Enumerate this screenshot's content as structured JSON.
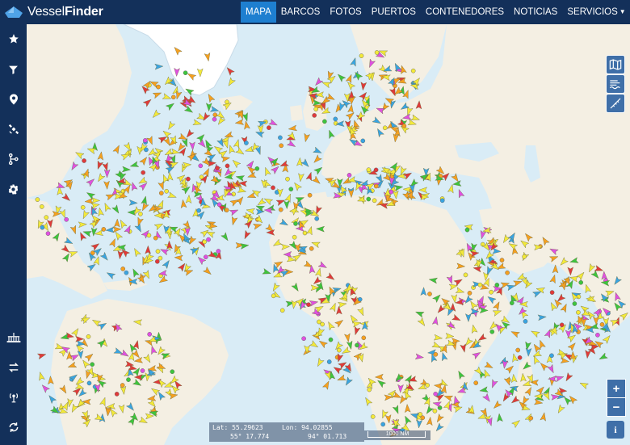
{
  "brand": {
    "name_part1": "Vessel",
    "name_part2": "Finder",
    "accent": "#1e7fd0",
    "navbar_color": "#13305a"
  },
  "nav": {
    "items": [
      {
        "label": "MAPA",
        "active": true
      },
      {
        "label": "BARCOS",
        "active": false
      },
      {
        "label": "FOTOS",
        "active": false
      },
      {
        "label": "PUERTOS",
        "active": false
      },
      {
        "label": "CONTENEDORES",
        "active": false
      },
      {
        "label": "NOTICIAS",
        "active": false
      },
      {
        "label": "SERVICIOS",
        "active": false,
        "has_dropdown": true
      }
    ]
  },
  "sidebar": {
    "top_items": [
      "star-icon",
      "filter-icon",
      "map-pin-icon",
      "satellite-icon",
      "route-icon",
      "gear-icon"
    ],
    "bottom_items": [
      "port-icon",
      "swap-icon",
      "antenna-icon",
      "refresh-icon"
    ]
  },
  "map_tools": [
    "map-layers-icon",
    "weather-icon",
    "measure-icon"
  ],
  "zoom": {
    "in_label": "+",
    "out_label": "−",
    "info_label": "i"
  },
  "coordinates": {
    "lat_decimal": "Lat: 55.29623",
    "lon_decimal": "Lon: 94.02855",
    "lat_dms": "55° 17.774",
    "lon_dms": "94° 01.713"
  },
  "scale": {
    "label": "1000 NM"
  },
  "vessel_colors": {
    "cargo": "#f3e93a",
    "tanker": "#f5a020",
    "passenger": "#3aa4e0",
    "special": "#e050e0",
    "fishing": "#3ec43e",
    "other": "#e03a3a"
  },
  "map_colors": {
    "sea": "#d9ecf6",
    "land": "#f4efe3",
    "ice": "#ffffff"
  }
}
